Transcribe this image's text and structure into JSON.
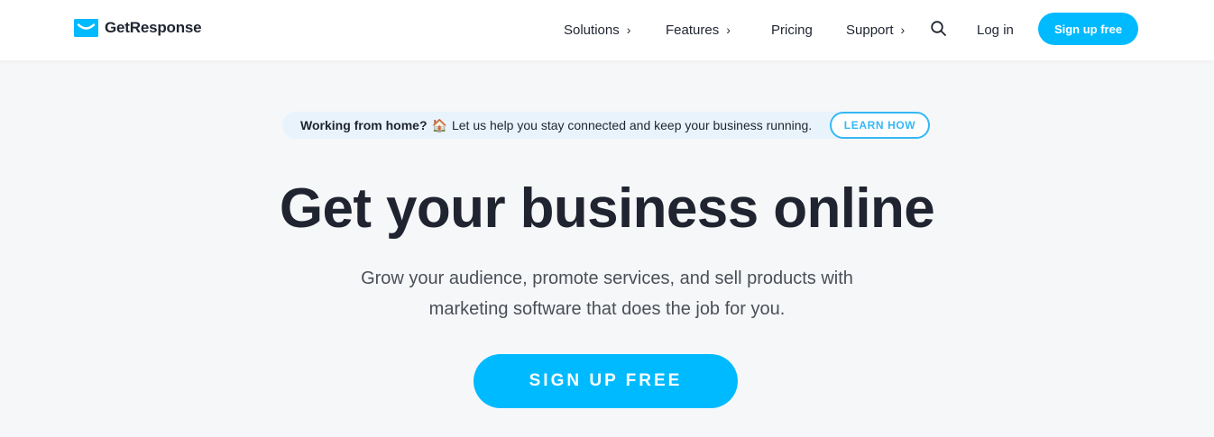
{
  "brand": {
    "name": "GetResponse",
    "logo_icon": "envelope-smile-icon",
    "accent_color": "#00baff",
    "outline_color": "#35b8f5"
  },
  "nav": {
    "solutions": "Solutions",
    "features": "Features",
    "pricing": "Pricing",
    "support": "Support",
    "chevron": "›",
    "search_icon": "search-icon",
    "login": "Log in",
    "signup": "Sign up free"
  },
  "banner": {
    "lead": "Working from home?",
    "emoji": "🏠",
    "message": "Let us help you stay connected and keep your business running.",
    "cta": "LEARN HOW"
  },
  "hero": {
    "title": "Get your business online",
    "subtitle": "Grow your audience, promote services, and sell products with marketing software that does the job for you.",
    "cta": "SIGN UP FREE"
  }
}
